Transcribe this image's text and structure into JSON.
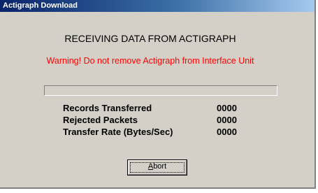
{
  "window": {
    "title": "Actigraph Download"
  },
  "main": {
    "heading": "RECEIVING DATA FROM ACTIGRAPH",
    "warning": "Warning!  Do not remove Actigraph from Interface Unit",
    "progress": {
      "fraction": 0
    },
    "stats": [
      {
        "label": "Records Transferred",
        "value": "0000"
      },
      {
        "label": "Rejected Packets",
        "value": "0000"
      },
      {
        "label": "Transfer Rate (Bytes/Sec)",
        "value": "0000"
      }
    ]
  },
  "buttons": {
    "abort": {
      "mnemonic": "A",
      "rest": "bort"
    }
  },
  "colors": {
    "titlebar_start": "#0a246a",
    "titlebar_end": "#a6caf0",
    "dialog_bg": "#d4d0c8",
    "warning_text": "#ff0000"
  }
}
